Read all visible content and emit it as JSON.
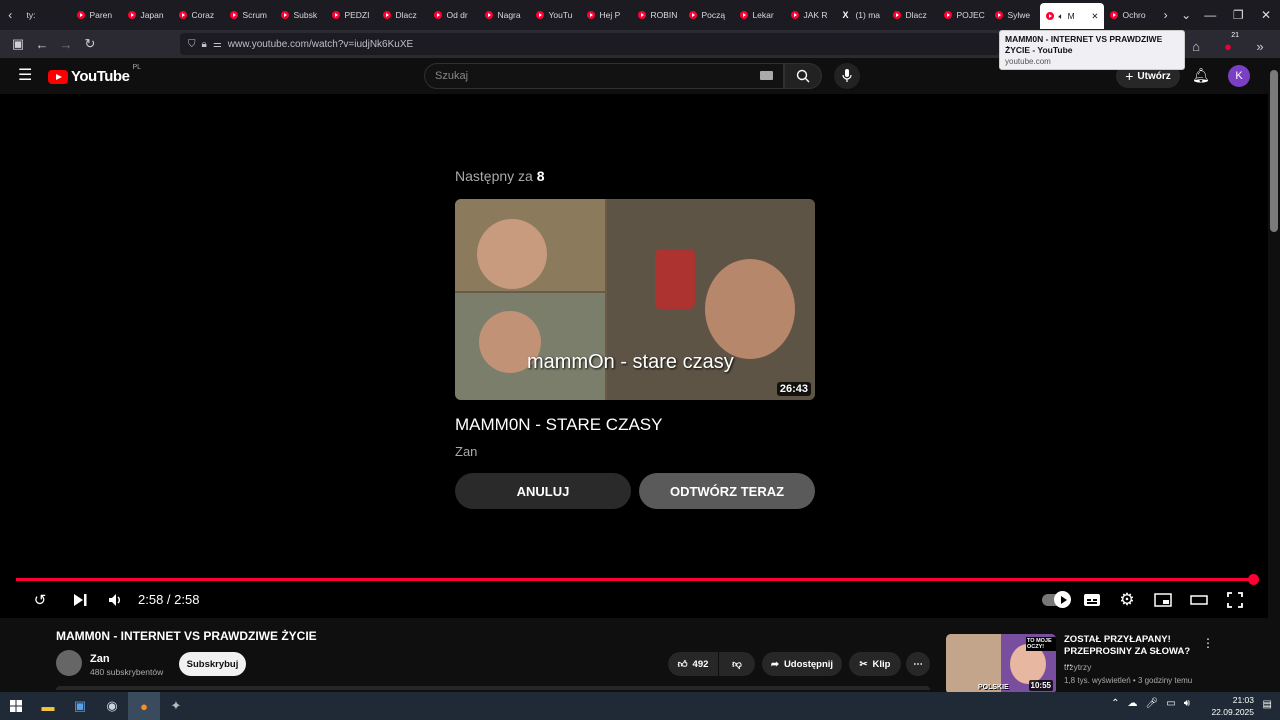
{
  "browser": {
    "tabs": [
      {
        "label": "ty:"
      },
      {
        "label": "Paren"
      },
      {
        "label": "Japan"
      },
      {
        "label": "Coraz"
      },
      {
        "label": "Scrum"
      },
      {
        "label": "Subsk"
      },
      {
        "label": "PEDZI"
      },
      {
        "label": "Dlacz"
      },
      {
        "label": "Od dr"
      },
      {
        "label": "Nagra"
      },
      {
        "label": "YouTu"
      },
      {
        "label": "Hej P"
      },
      {
        "label": "ROBIN"
      },
      {
        "label": "Począ"
      },
      {
        "label": "Lekar"
      },
      {
        "label": "JAK R"
      },
      {
        "label": "(1) ma"
      },
      {
        "label": "Dlacz"
      },
      {
        "label": "POJEC"
      },
      {
        "label": "Sylwe"
      },
      {
        "label": "M"
      },
      {
        "label": "Ochro"
      }
    ],
    "url": "www.youtube.com/watch?v=iudjNk6KuXE",
    "tooltip": {
      "title": "MAMM0N - INTERNET VS PRAWDZIWE ŻYCIE - YouTube",
      "domain": "youtube.com"
    },
    "badge_count": "21"
  },
  "youtube": {
    "logo_text": "YouTube",
    "region": "PL",
    "search_placeholder": "Szukaj",
    "create_label": "Utwórz",
    "avatar_letter": "K"
  },
  "endscreen": {
    "up_next_prefix": "Następny za",
    "countdown": "8",
    "thumb_caption": "mammOn - stare czasy",
    "duration": "26:43",
    "title": "MAMM0N - STARE CZASY",
    "channel": "Zan",
    "cancel_label": "ANULUJ",
    "play_now_label": "ODTWÓRZ TERAZ"
  },
  "player": {
    "time": "2:58 / 2:58",
    "progress_fraction": 1.0
  },
  "video": {
    "title": "MAMM0N - INTERNET VS PRAWDZIWE ŻYCIE",
    "channel": "Zan",
    "subscribers": "480 subskrybentów",
    "subscribe_label": "Subskrybuj",
    "likes": "492",
    "share_label": "Udostępnij",
    "clip_label": "Klip"
  },
  "recommendation": {
    "title": "ZOSTAŁ PRZYŁAPANY! PRZEPROSINY ZA SŁOWA? ...",
    "channel": "trzytrzy",
    "meta": "1,8 tys. wyświetleń • 3 godziny temu",
    "duration": "10:55",
    "thumb_text_1": "TO MOJE OCZY!",
    "thumb_text_2": "POLSKIE"
  },
  "taskbar": {
    "time": "21:03",
    "date": "22.09.2025"
  }
}
